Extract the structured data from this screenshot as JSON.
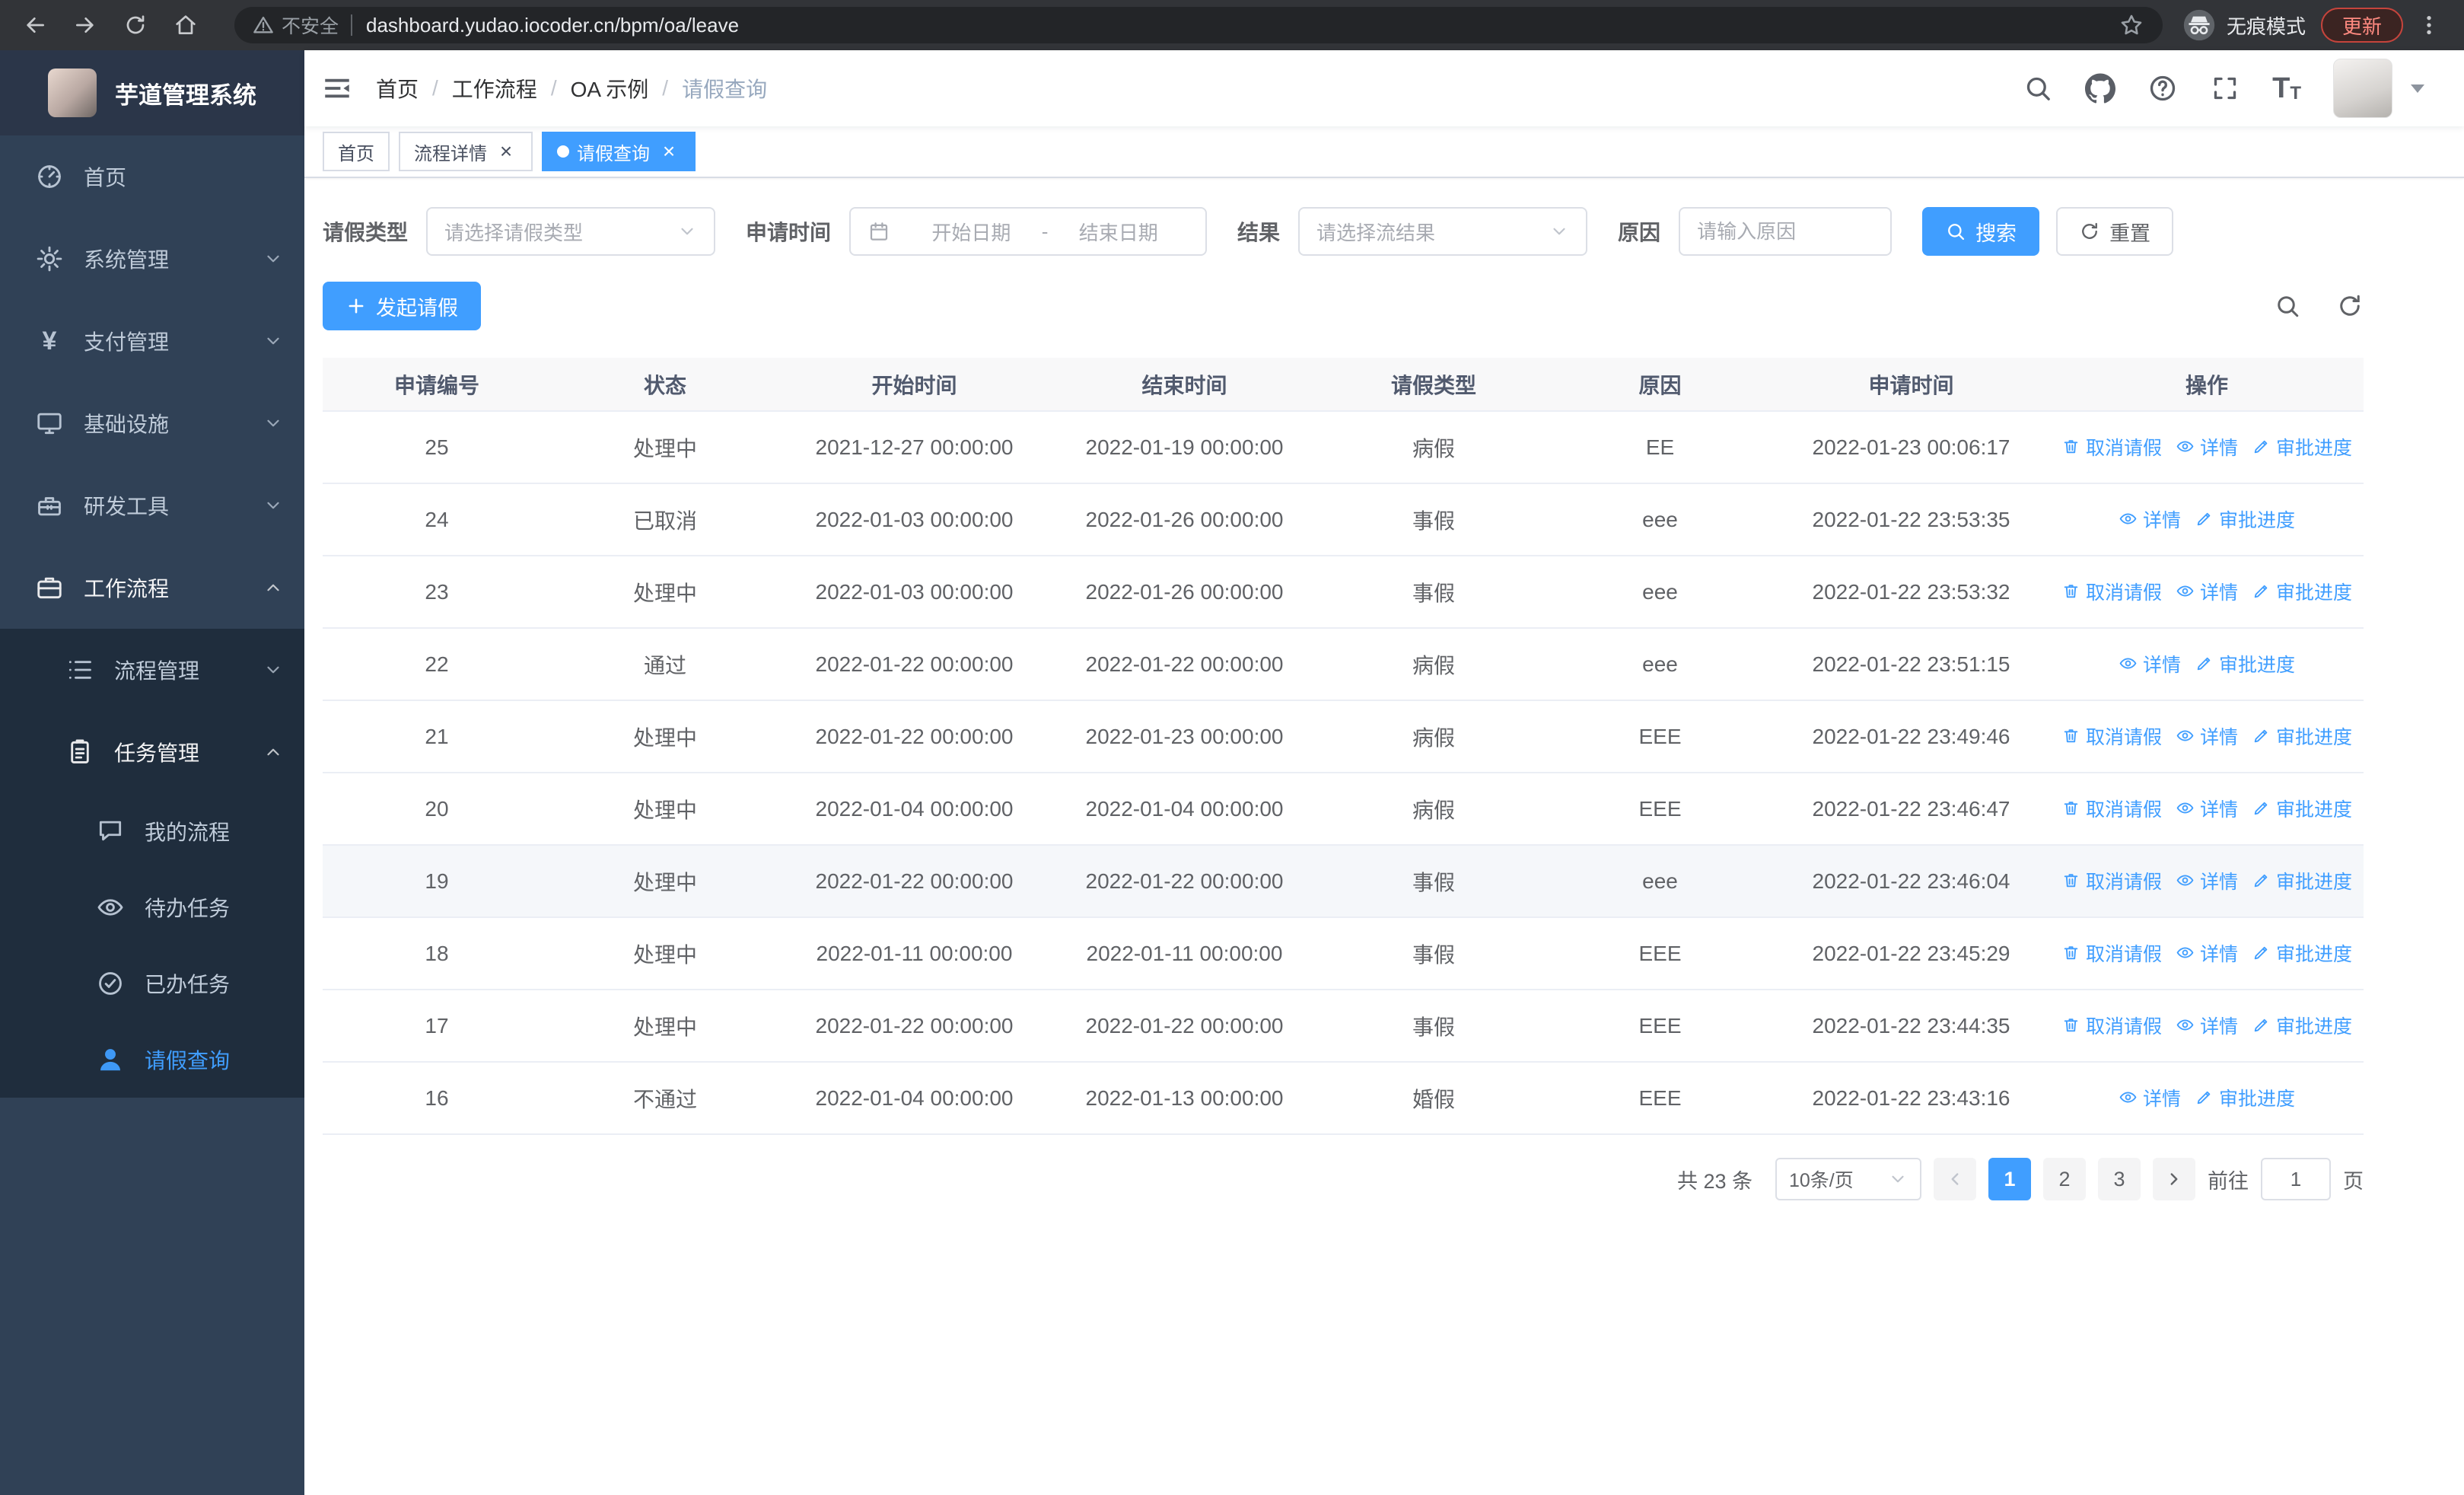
{
  "colors": {
    "accent": "#409eff",
    "sidebar_bg": "#304156",
    "submenu_bg": "#1f2d3d"
  },
  "browser": {
    "security_label": "不安全",
    "url": "dashboard.yudao.iocoder.cn/bpm/oa/leave",
    "incognito_label": "无痕模式",
    "update_label": "更新"
  },
  "header": {
    "breadcrumb": [
      "首页",
      "工作流程",
      "OA 示例",
      "请假查询"
    ]
  },
  "tabs": [
    {
      "key": "home",
      "label": "首页",
      "closable": false,
      "active": false
    },
    {
      "key": "process-detail",
      "label": "流程详情",
      "closable": true,
      "active": false
    },
    {
      "key": "leave-query",
      "label": "请假查询",
      "closable": true,
      "active": true
    }
  ],
  "sidebar": {
    "title": "芋道管理系统",
    "menu": [
      {
        "key": "home",
        "label": "首页",
        "icon": "dashboard-icon"
      },
      {
        "key": "system",
        "label": "系统管理",
        "icon": "gear-icon",
        "arrow": "down"
      },
      {
        "key": "payment",
        "label": "支付管理",
        "icon": "yen-icon",
        "arrow": "down"
      },
      {
        "key": "infrastructure",
        "label": "基础设施",
        "icon": "monitor-icon",
        "arrow": "down"
      },
      {
        "key": "devtools",
        "label": "研发工具",
        "icon": "toolbox-icon",
        "arrow": "down"
      },
      {
        "key": "workflow",
        "label": "工作流程",
        "icon": "briefcase-icon",
        "arrow": "up",
        "expanded": true
      }
    ],
    "submenu": [
      {
        "key": "process-mgmt",
        "label": "流程管理",
        "icon": "tree-icon",
        "arrow": "down",
        "level": 2
      },
      {
        "key": "task-mgmt",
        "label": "任务管理",
        "icon": "clipboard-icon",
        "arrow": "up",
        "level": 2,
        "expanded": true
      },
      {
        "key": "my-process",
        "label": "我的流程",
        "icon": "chat-icon",
        "level": 3
      },
      {
        "key": "todo-task",
        "label": "待办任务",
        "icon": "eye-icon",
        "level": 3
      },
      {
        "key": "done-task",
        "label": "已办任务",
        "icon": "check-icon",
        "level": 3
      },
      {
        "key": "leave-query",
        "label": "请假查询",
        "icon": "user-icon",
        "level": 3,
        "active": true
      }
    ]
  },
  "filters": {
    "leave_type": {
      "label": "请假类型",
      "placeholder": "请选择请假类型"
    },
    "apply_time": {
      "label": "申请时间",
      "start_placeholder": "开始日期",
      "separator": "-",
      "end_placeholder": "结束日期"
    },
    "result": {
      "label": "结果",
      "placeholder": "请选择流结果"
    },
    "reason": {
      "label": "原因",
      "placeholder": "请输入原因"
    },
    "search_label": "搜索",
    "reset_label": "重置"
  },
  "toolbar": {
    "create_label": "发起请假"
  },
  "table": {
    "columns": [
      "申请编号",
      "状态",
      "开始时间",
      "结束时间",
      "请假类型",
      "原因",
      "申请时间",
      "操作"
    ],
    "action_defs": {
      "cancel": {
        "label": "取消请假",
        "icon": "trash-icon"
      },
      "detail": {
        "label": "详情",
        "icon": "eye-icon"
      },
      "progress": {
        "label": "审批进度",
        "icon": "edit-icon"
      }
    },
    "rows": [
      {
        "id": "25",
        "status": "处理中",
        "start": "2021-12-27 00:00:00",
        "end": "2022-01-19 00:00:00",
        "type": "病假",
        "reason": "EE",
        "apply_time": "2022-01-23 00:06:17",
        "actions": [
          "cancel",
          "detail",
          "progress"
        ]
      },
      {
        "id": "24",
        "status": "已取消",
        "start": "2022-01-03 00:00:00",
        "end": "2022-01-26 00:00:00",
        "type": "事假",
        "reason": "eee",
        "apply_time": "2022-01-22 23:53:35",
        "actions": [
          "detail",
          "progress"
        ]
      },
      {
        "id": "23",
        "status": "处理中",
        "start": "2022-01-03 00:00:00",
        "end": "2022-01-26 00:00:00",
        "type": "事假",
        "reason": "eee",
        "apply_time": "2022-01-22 23:53:32",
        "actions": [
          "cancel",
          "detail",
          "progress"
        ]
      },
      {
        "id": "22",
        "status": "通过",
        "start": "2022-01-22 00:00:00",
        "end": "2022-01-22 00:00:00",
        "type": "病假",
        "reason": "eee",
        "apply_time": "2022-01-22 23:51:15",
        "actions": [
          "detail",
          "progress"
        ]
      },
      {
        "id": "21",
        "status": "处理中",
        "start": "2022-01-22 00:00:00",
        "end": "2022-01-23 00:00:00",
        "type": "病假",
        "reason": "EEE",
        "apply_time": "2022-01-22 23:49:46",
        "actions": [
          "cancel",
          "detail",
          "progress"
        ]
      },
      {
        "id": "20",
        "status": "处理中",
        "start": "2022-01-04 00:00:00",
        "end": "2022-01-04 00:00:00",
        "type": "病假",
        "reason": "EEE",
        "apply_time": "2022-01-22 23:46:47",
        "actions": [
          "cancel",
          "detail",
          "progress"
        ]
      },
      {
        "id": "19",
        "status": "处理中",
        "start": "2022-01-22 00:00:00",
        "end": "2022-01-22 00:00:00",
        "type": "事假",
        "reason": "eee",
        "apply_time": "2022-01-22 23:46:04",
        "actions": [
          "cancel",
          "detail",
          "progress"
        ],
        "highlighted": true
      },
      {
        "id": "18",
        "status": "处理中",
        "start": "2022-01-11 00:00:00",
        "end": "2022-01-11 00:00:00",
        "type": "事假",
        "reason": "EEE",
        "apply_time": "2022-01-22 23:45:29",
        "actions": [
          "cancel",
          "detail",
          "progress"
        ]
      },
      {
        "id": "17",
        "status": "处理中",
        "start": "2022-01-22 00:00:00",
        "end": "2022-01-22 00:00:00",
        "type": "事假",
        "reason": "EEE",
        "apply_time": "2022-01-22 23:44:35",
        "actions": [
          "cancel",
          "detail",
          "progress"
        ]
      },
      {
        "id": "16",
        "status": "不通过",
        "start": "2022-01-04 00:00:00",
        "end": "2022-01-13 00:00:00",
        "type": "婚假",
        "reason": "EEE",
        "apply_time": "2022-01-22 23:43:16",
        "actions": [
          "detail",
          "progress"
        ]
      }
    ]
  },
  "pagination": {
    "total_text": "共 23 条",
    "page_size": "10条/页",
    "pages": [
      "1",
      "2",
      "3"
    ],
    "active_page": "1",
    "goto_prefix": "前往",
    "goto_value": "1",
    "goto_suffix": "页"
  }
}
